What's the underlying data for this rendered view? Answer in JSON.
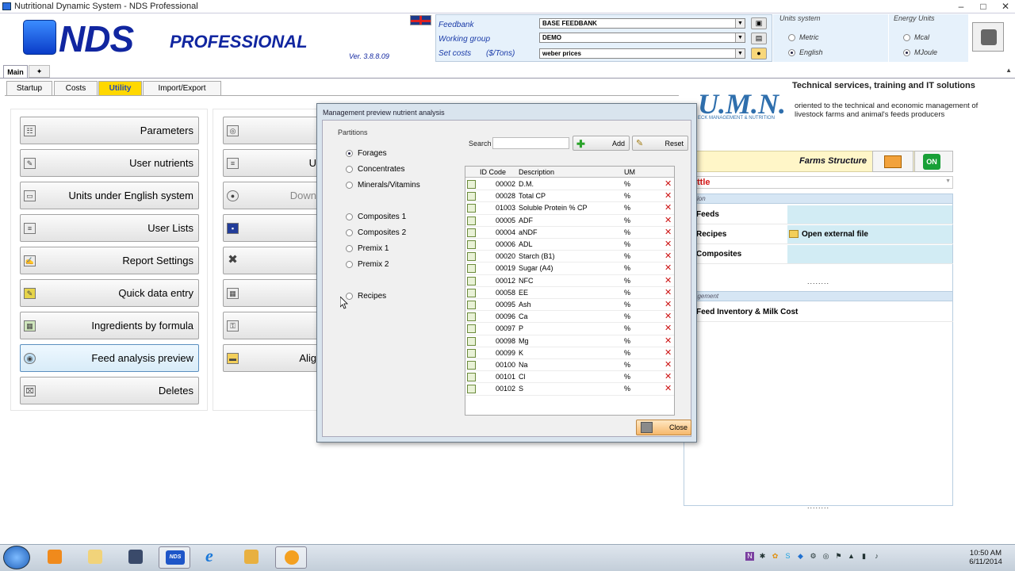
{
  "window": {
    "title": "Nutritional Dynamic System - NDS Professional",
    "controls": [
      "–",
      "□",
      "✕"
    ]
  },
  "header": {
    "brand": "NDS",
    "brand_suffix": "PROFESSIONAL",
    "version": "Ver. 3.8.8.09",
    "feedbank_label": "Feedbank",
    "feedbank_value": "BASE FEEDBANK",
    "working_group_label": "Working group",
    "working_group_value": "DEMO",
    "set_costs_label": "Set costs",
    "set_costs_unit": "($/Tons)",
    "set_costs_value": "weber prices",
    "units_title": "Units system",
    "unit_metric": "Metric",
    "unit_english": "English",
    "units_selected": "English",
    "energy_title": "Energy Units",
    "energy_mcal": "Mcal",
    "energy_mjoule": "MJoule",
    "energy_selected": "MJoule"
  },
  "tabs": {
    "main": "Main"
  },
  "subtabs": [
    "Startup",
    "Costs",
    "Utility",
    "Import/Export"
  ],
  "active_subtab": "Utility",
  "left_buttons": [
    "Parameters",
    "User nutrients",
    "Units under English system",
    "User Lists",
    "Report Settings",
    "Quick data entry",
    "Ingredients by formula",
    "Feed analysis preview",
    "Deletes"
  ],
  "mid_buttons": [
    "",
    "U",
    "Down",
    "",
    "",
    "",
    "",
    "Alig"
  ],
  "right": {
    "tech_title": "Technical services, training and IT solutions",
    "tech_desc": "oriented to the technical and economic management of livestock farms and animal's feeds producers",
    "umn_logo": "U.M.N.",
    "umn_sub": "ECK MANAGEMENT & NUTRITION",
    "farms_structure": "Farms Structure",
    "on_label": "ON",
    "cattle": "ttle",
    "section1": "ition",
    "feeds": "Feeds",
    "recipes": "Recipes",
    "open_external": "Open external file",
    "composites": "Composites",
    "dots": "........",
    "section2": "agement",
    "feed_inventory": "Feed Inventory & Milk Cost"
  },
  "dialog": {
    "title": "Management preview nutrient analysis",
    "partitions_title": "Partitions",
    "partitions": [
      "Forages",
      "Concentrates",
      "Minerals/Vitamins",
      "Composites 1",
      "Composites 2",
      "Premix 1",
      "Premix 2",
      "Recipes"
    ],
    "selected_partition": "Forages",
    "search_label": "Search",
    "search_value": "",
    "add_label": "Add",
    "reset_label": "Reset",
    "columns": [
      "ID Code",
      "Description",
      "UM"
    ],
    "rows": [
      {
        "code": "00002",
        "desc": "D.M.",
        "um": "%"
      },
      {
        "code": "00028",
        "desc": "Total CP",
        "um": "%"
      },
      {
        "code": "01003",
        "desc": "Soluble Protein % CP",
        "um": "%"
      },
      {
        "code": "00005",
        "desc": "ADF",
        "um": "%"
      },
      {
        "code": "00004",
        "desc": "aNDF",
        "um": "%"
      },
      {
        "code": "00006",
        "desc": "ADL",
        "um": "%"
      },
      {
        "code": "00020",
        "desc": "Starch (B1)",
        "um": "%"
      },
      {
        "code": "00019",
        "desc": "Sugar (A4)",
        "um": "%"
      },
      {
        "code": "00012",
        "desc": "NFC",
        "um": "%"
      },
      {
        "code": "00058",
        "desc": "EE",
        "um": "%"
      },
      {
        "code": "00095",
        "desc": "Ash",
        "um": "%"
      },
      {
        "code": "00096",
        "desc": "Ca",
        "um": "%"
      },
      {
        "code": "00097",
        "desc": "P",
        "um": "%"
      },
      {
        "code": "00098",
        "desc": "Mg",
        "um": "%"
      },
      {
        "code": "00099",
        "desc": "K",
        "um": "%"
      },
      {
        "code": "00100",
        "desc": "Na",
        "um": "%"
      },
      {
        "code": "00101",
        "desc": "Cl",
        "um": "%"
      },
      {
        "code": "00102",
        "desc": "S",
        "um": "%"
      }
    ],
    "close_label": "Close"
  },
  "taskbar": {
    "time": "10:50 AM",
    "date": "6/11/2014",
    "nds_label": "NDS"
  }
}
